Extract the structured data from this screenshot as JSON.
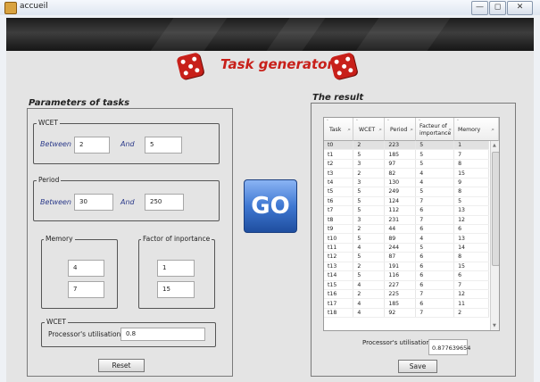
{
  "window": {
    "title": "accueil",
    "controls": [
      "—",
      "◻",
      "✕"
    ]
  },
  "header": {
    "title": "Task generator"
  },
  "params": {
    "heading": "Parameters of tasks",
    "wcet": {
      "group_label": "WCET",
      "between_label": "Between",
      "and_label": "And",
      "min": "2",
      "max": "5"
    },
    "period": {
      "group_label": "Period",
      "between_label": "Between",
      "and_label": "And",
      "min": "30",
      "max": "250"
    },
    "memory": {
      "group_label": "Memory",
      "value1": "4",
      "value2": "7"
    },
    "factor": {
      "group_label": "Factor of inportance",
      "value1": "1",
      "value2": "15"
    },
    "wcet_util": {
      "group_label": "WCET",
      "label": "Processor's utilisation",
      "value": "0.8"
    },
    "reset_label": "Reset"
  },
  "go_label": "GO",
  "result": {
    "heading": "The result",
    "columns": [
      {
        "label": "Task"
      },
      {
        "label": "WCET"
      },
      {
        "label": "Period"
      },
      {
        "label": "Facteur of importance"
      },
      {
        "label": "Memory"
      }
    ],
    "filter_glyph": "⌕",
    "sort_glyph": "⌃",
    "rows": [
      [
        "t0",
        "2",
        "223",
        "5",
        "1"
      ],
      [
        "t1",
        "5",
        "185",
        "5",
        "7"
      ],
      [
        "t2",
        "3",
        "97",
        "5",
        "8"
      ],
      [
        "t3",
        "2",
        "82",
        "4",
        "15"
      ],
      [
        "t4",
        "3",
        "130",
        "4",
        "9"
      ],
      [
        "t5",
        "5",
        "249",
        "5",
        "8"
      ],
      [
        "t6",
        "5",
        "124",
        "7",
        "5"
      ],
      [
        "t7",
        "5",
        "112",
        "6",
        "13"
      ],
      [
        "t8",
        "3",
        "231",
        "7",
        "12"
      ],
      [
        "t9",
        "2",
        "44",
        "6",
        "6"
      ],
      [
        "t10",
        "5",
        "89",
        "4",
        "13"
      ],
      [
        "t11",
        "4",
        "244",
        "5",
        "14"
      ],
      [
        "t12",
        "5",
        "87",
        "6",
        "8"
      ],
      [
        "t13",
        "2",
        "191",
        "6",
        "15"
      ],
      [
        "t14",
        "5",
        "116",
        "6",
        "6"
      ],
      [
        "t15",
        "4",
        "227",
        "6",
        "7"
      ],
      [
        "t16",
        "2",
        "225",
        "7",
        "12"
      ],
      [
        "t17",
        "4",
        "185",
        "6",
        "11"
      ],
      [
        "t18",
        "4",
        "92",
        "7",
        "2"
      ]
    ],
    "util_label": "Processor's utilisation",
    "util_value": "0.877639654",
    "save_label": "Save"
  },
  "colors": {
    "accent_blue": "#2b3a8a",
    "dice_red": "#c8201a",
    "title_red": "#c8201a",
    "go_blue": "#3f78d2"
  }
}
